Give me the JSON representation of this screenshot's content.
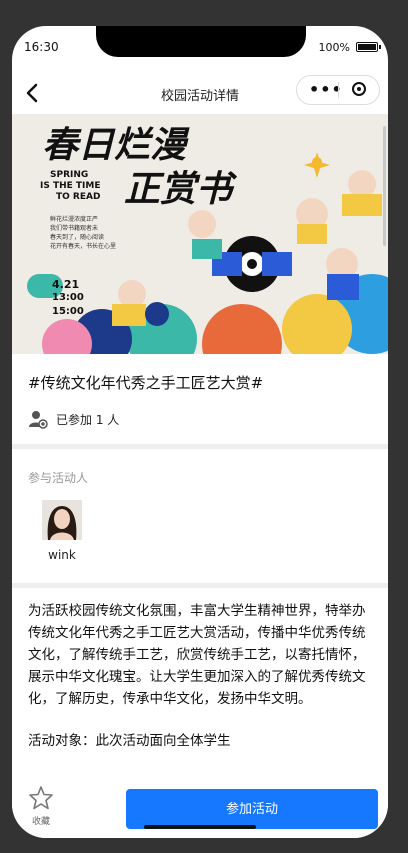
{
  "status_bar": {
    "time": "16:30",
    "battery": "100%"
  },
  "nav": {
    "title": "校园活动详情"
  },
  "poster": {
    "title_line1": "春日烂漫",
    "title_line2": "正赏书",
    "slogan_line1": "SPRING",
    "slogan_line2": "IS THE TIME",
    "slogan_line3": "TO READ",
    "blurb_line1": "鲜花烂漫浓度正严",
    "blurb_line2": "我们带书籍观者未",
    "blurb_line3": "春天到了，随心阅读",
    "blurb_line4": "花开有春天，书长在心里",
    "date": "4.21",
    "time1": "13:00",
    "time2": "15:00"
  },
  "activity": {
    "title": "#传统文化年代秀之手工匠艺大赏#",
    "joined_text": "已参加 1 人"
  },
  "participants": {
    "label": "参与活动人",
    "items": [
      {
        "name": "wink"
      }
    ]
  },
  "description": {
    "text": "为活跃校园传统文化氛围，丰富大学生精神世界，特举办传统文化年代秀之手工匠艺大赏活动，传播中华优秀传统文化，了解传统手工艺，欣赏传统手工艺，以寄托情怀，展示中华文化瑰宝。让大学生更加深入的了解优秀传统文化，了解历史，传承中华文化，发扬中华文明。",
    "target": "活动对象：此次活动面向全体学生"
  },
  "bottom": {
    "favorite_label": "收藏",
    "join_label": "参加活动"
  },
  "colors": {
    "accent": "#1677ff",
    "poster_bg": "#efebe5"
  }
}
